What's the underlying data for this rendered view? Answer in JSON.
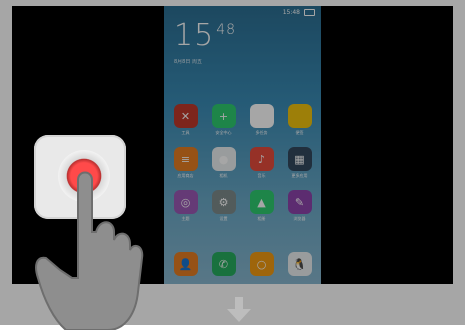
{
  "status_bar": {
    "time_small": "15:48"
  },
  "lockscreen": {
    "hour": "15",
    "minute": "48",
    "date_text": "8月8日 周五"
  },
  "apps": [
    {
      "name": "cancel",
      "label": "工具",
      "color": "#c0392b",
      "glyph": "✕"
    },
    {
      "name": "security",
      "label": "安全中心",
      "color": "#2ecc71",
      "glyph": "+"
    },
    {
      "name": "switcher",
      "label": "多任务",
      "color": "#ffffff",
      "glyph": "▭"
    },
    {
      "name": "notes",
      "label": "便签",
      "color": "#f1c40f",
      "glyph": ""
    },
    {
      "name": "store",
      "label": "应用商店",
      "color": "#e67e22",
      "glyph": "≡"
    },
    {
      "name": "camera",
      "label": "相机",
      "color": "#ecf0f1",
      "glyph": "●"
    },
    {
      "name": "music",
      "label": "音乐",
      "color": "#e74c3c",
      "glyph": "♪"
    },
    {
      "name": "apps",
      "label": "更多应用",
      "color": "#34495e",
      "glyph": "▦"
    },
    {
      "name": "theme",
      "label": "主题",
      "color": "#9b59b6",
      "glyph": "◎"
    },
    {
      "name": "settings",
      "label": "设置",
      "color": "#7f8c8d",
      "glyph": "⚙"
    },
    {
      "name": "gallery",
      "label": "相册",
      "color": "#2ecc71",
      "glyph": "▲"
    },
    {
      "name": "browser",
      "label": "浏览器",
      "color": "#8e44ad",
      "glyph": "✎"
    }
  ],
  "dock": [
    {
      "name": "contacts",
      "color": "#e67e22",
      "glyph": "👤"
    },
    {
      "name": "phone",
      "color": "#27ae60",
      "glyph": "✆"
    },
    {
      "name": "messages",
      "color": "#f39c12",
      "glyph": "○"
    },
    {
      "name": "qq",
      "color": "#ecf0f1",
      "glyph": "🐧"
    }
  ]
}
